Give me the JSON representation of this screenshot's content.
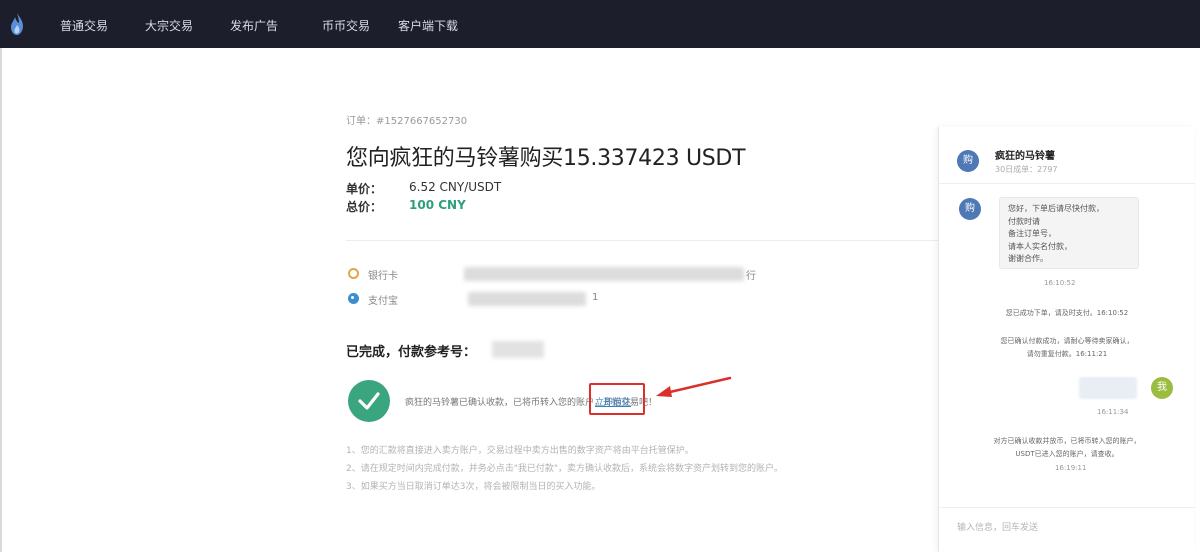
{
  "nav": {
    "items": [
      "普通交易",
      "大宗交易",
      "发布广告",
      "币币交易",
      "客户端下载"
    ]
  },
  "order": {
    "number": "订单：#1527667652730",
    "title": "您向疯狂的马铃薯购买15.337423 USDT",
    "unit_price_label": "单价：",
    "unit_price_value": "6.52 CNY/USDT",
    "total_label": "总价：",
    "total_value": "100 CNY"
  },
  "payment": {
    "bank_label": "银行卡",
    "bank_tail": "行",
    "alipay_label": "支付宝",
    "alipay_tail": "1"
  },
  "status": {
    "completed_label": "已完成，付款参考号：",
    "message": "疯狂的马铃薯已确认收款，已将币转入您的账户，开始交易吧！",
    "link_label": "立即前往"
  },
  "notes": [
    "1、您的汇款将直接进入卖方账户，交易过程中卖方出售的数字资产将由平台托管保护。",
    "2、请在规定时间内完成付款，并务必点击\"我已付款\"，卖方确认收款后，系统会将数字资产划转到您的账户。",
    "3、如果买方当日取消订单达3次，将会被限制当日的买入功能。"
  ],
  "chat": {
    "name": "疯狂的马铃薯",
    "subtitle": "30日成单：2797",
    "avatar_letter": "购",
    "buyer_avatar_letter": "我",
    "bubble_lines": [
      "您好，下单后请尽快付款，",
      "付款时请",
      "备注订单号，",
      "请本人实名付款，",
      "谢谢合作。"
    ],
    "time1": "16:10:52",
    "sys1": "您已成功下单，请及时支付。16:10:52",
    "sys2a": "您已确认付款成功，请耐心等待卖家确认，",
    "sys2b": "请勿重复付款。16:11:21",
    "time2": "16:11:34",
    "sys3a": "对方已确认收款并放币，已将币转入您的账户，",
    "sys3b": "USDT已进入您的账户，请查收。",
    "time3": "16:19:11",
    "input_placeholder": "输入信息，回车发送"
  },
  "colors": {
    "nav_bg": "#1c1e2c",
    "accent_green": "#2f9e7d",
    "check_green": "#3aa57e",
    "highlight_red": "#d9302b",
    "link_blue": "#3a7fc4"
  }
}
